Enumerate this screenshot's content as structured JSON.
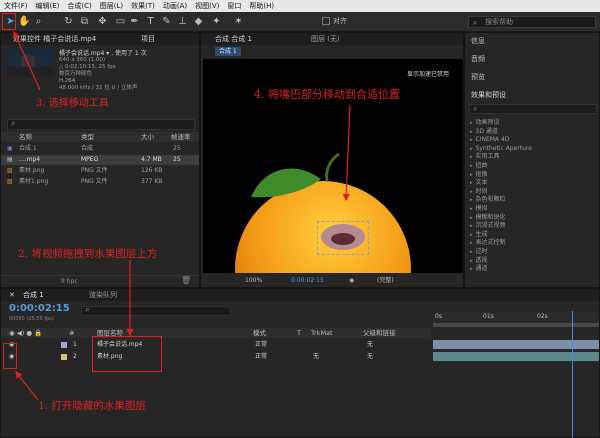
{
  "menu": [
    "文件(F)",
    "编辑(E)",
    "合成(C)",
    "图层(L)",
    "效果(T)",
    "动画(A)",
    "视图(V)",
    "窗口",
    "帮助(H)"
  ],
  "toolbar": {
    "align_label": "对齐",
    "search_placeholder": "搜索帮助"
  },
  "project": {
    "tab_effects": "效果控件 橘子会说话.mp4",
    "tab_project": "项目",
    "file_name": "橘子会说话.mp4 ▾ , 使用了 1 次",
    "file_info": [
      "640 x 360 (1.00)",
      "△ 0:02:10:15, 25 fps",
      "数百万种颜色",
      "H.264",
      "48.000 kHz / 32 位 U / 立体声"
    ],
    "columns": [
      "名称",
      "类型",
      "大小",
      "帧速率"
    ],
    "items": [
      {
        "name": "合成 1",
        "type": "合成",
        "size": "",
        "fps": "25"
      },
      {
        "name": "....mp4",
        "type": "MPEG",
        "size": "4.7 MB",
        "fps": "25"
      },
      {
        "name": "素材.png",
        "type": "PNG 文件",
        "size": "126 KB",
        "fps": ""
      },
      {
        "name": "素材1.png",
        "type": "PNG 文件",
        "size": "377 KB",
        "fps": ""
      }
    ],
    "bpc": "8 bpc"
  },
  "composition": {
    "tab": "合成 合成 1",
    "layer_tab": "图层 (无)",
    "sub_tab": "合成 1",
    "gpu_note": "显示加速已禁用",
    "zoom": "100%",
    "time": "0:00:02:15",
    "quality": "(完整)"
  },
  "right_panel": {
    "items": [
      "信息",
      "音频",
      "预览",
      "效果和预设"
    ],
    "effects": [
      "动画预设",
      "3D 通道",
      "CINEMA 4D",
      "Synthetic Aperture",
      "实用工具",
      "扭曲",
      "抠像",
      "文本",
      "时间",
      "杂色和颗粒",
      "模拟",
      "模糊和锐化",
      "沉浸式视频",
      "生成",
      "表达式控制",
      "过时",
      "透视",
      "通道"
    ]
  },
  "timeline": {
    "tab_comp": "合成 1",
    "tab_render": "渲染队列",
    "timecode": "0:00:02:15",
    "timecode_sub": "00065 (25.00 fps)",
    "columns": {
      "name": "图层名称",
      "mode": "模式",
      "t": "T",
      "trkmat": "TrkMat",
      "parent": "父级和链接"
    },
    "layers": [
      {
        "num": "1",
        "name": "橘子会说话.mp4",
        "mode": "正常",
        "trk": "",
        "parent": "无"
      },
      {
        "num": "2",
        "name": "素材.png",
        "mode": "正常",
        "trk": "无",
        "parent": "无"
      }
    ],
    "ruler": [
      "0s",
      "01s",
      "02s"
    ]
  },
  "annotations": {
    "step1": "1. 打开隐藏的水果图层",
    "step2": "2. 将视频拖拽到水果图层上方",
    "step3": "3. 选择移动工具",
    "step4": "4. 将嘴巴部分移动到合适位置"
  },
  "colors": {
    "accent_red": "#e02020",
    "timecode_blue": "#5a9bd8",
    "playhead": "#3d8fe0"
  }
}
